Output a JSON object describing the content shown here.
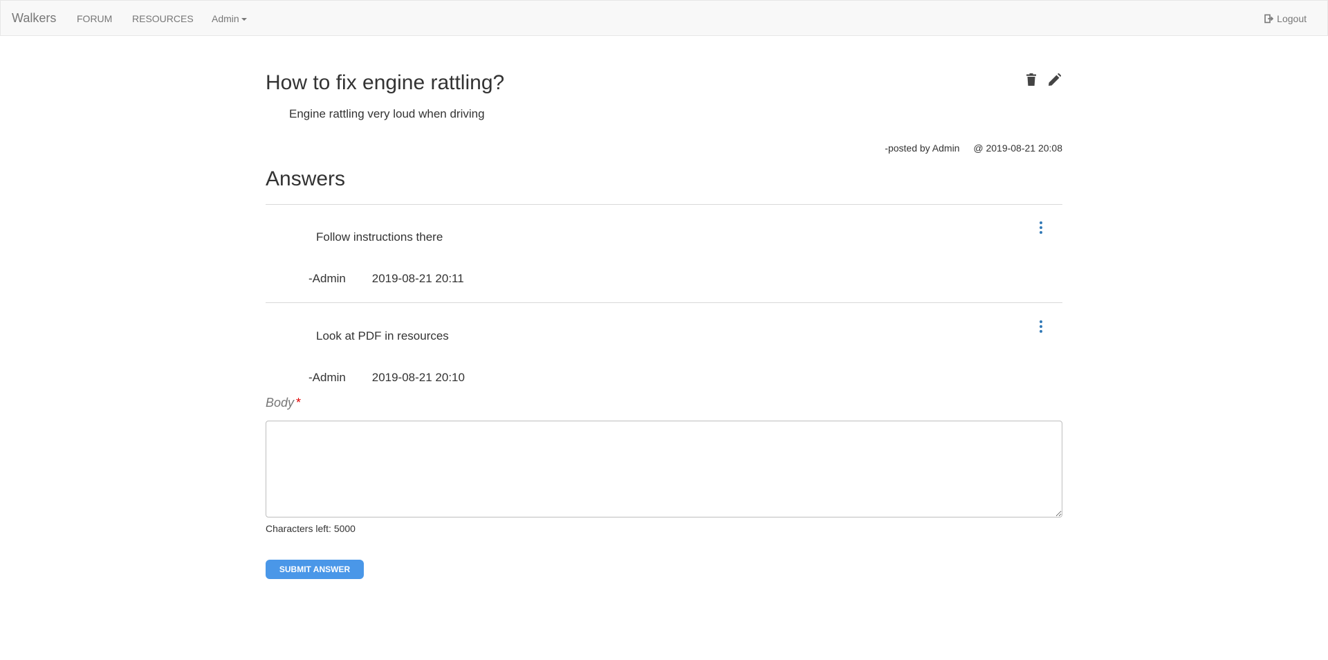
{
  "navbar": {
    "brand": "Walkers",
    "links": [
      {
        "label": "FORUM"
      },
      {
        "label": "RESOURCES"
      }
    ],
    "user_menu_label": "Admin",
    "logout_label": "Logout"
  },
  "question": {
    "title": "How to fix engine rattling?",
    "body": "Engine rattling very loud when driving",
    "posted_by": "-posted by Admin",
    "posted_at": "@ 2019-08-21 20:08",
    "actions": [
      {
        "icon": "trash-icon"
      },
      {
        "icon": "pencil-icon"
      }
    ]
  },
  "answers": {
    "heading": "Answers",
    "items": [
      {
        "body": "Follow instructions there",
        "author": "-Admin",
        "timestamp": "2019-08-21 20:11",
        "menu_icon": "kebab-menu-icon"
      },
      {
        "body": "Look at PDF in resources",
        "author": "-Admin",
        "timestamp": "2019-08-21 20:10",
        "menu_icon": "kebab-menu-icon"
      }
    ]
  },
  "answer_form": {
    "label": "Body",
    "required_marker": "*",
    "value": "",
    "chars_left": "Characters left: 5000",
    "submit_label": "SUBMIT ANSWER"
  },
  "colors": {
    "navbar_bg": "#f8f8f8",
    "submit_bg": "#4a97e8",
    "kebab": "#337ab7",
    "required": "#e00000"
  }
}
